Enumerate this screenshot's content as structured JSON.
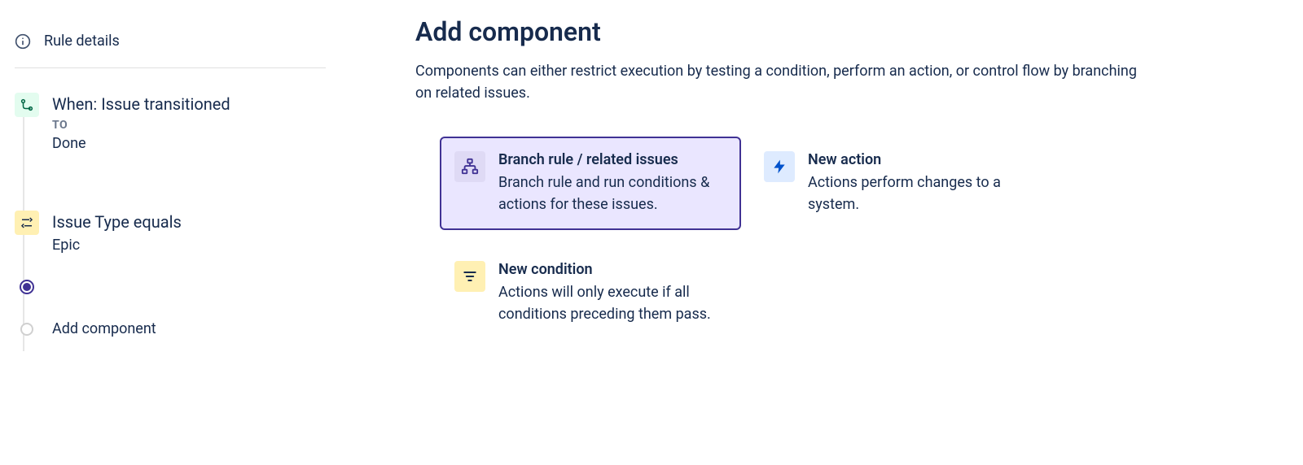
{
  "sidebar": {
    "ruleDetailsLabel": "Rule details",
    "trigger": {
      "title": "When: Issue transitioned",
      "subLabel": "TO",
      "value": "Done"
    },
    "condition": {
      "title": "Issue Type equals",
      "value": "Epic"
    },
    "addComponentLabel": "Add component"
  },
  "main": {
    "title": "Add component",
    "description": "Components can either restrict execution by testing a condition, perform an action, or control flow by branching on related issues.",
    "cards": {
      "branch": {
        "title": "Branch rule / related issues",
        "description": "Branch rule and run conditions & actions for these issues."
      },
      "action": {
        "title": "New action",
        "description": "Actions perform changes to a system."
      },
      "condition": {
        "title": "New condition",
        "description": "Actions will only execute if all conditions preceding them pass."
      }
    }
  }
}
